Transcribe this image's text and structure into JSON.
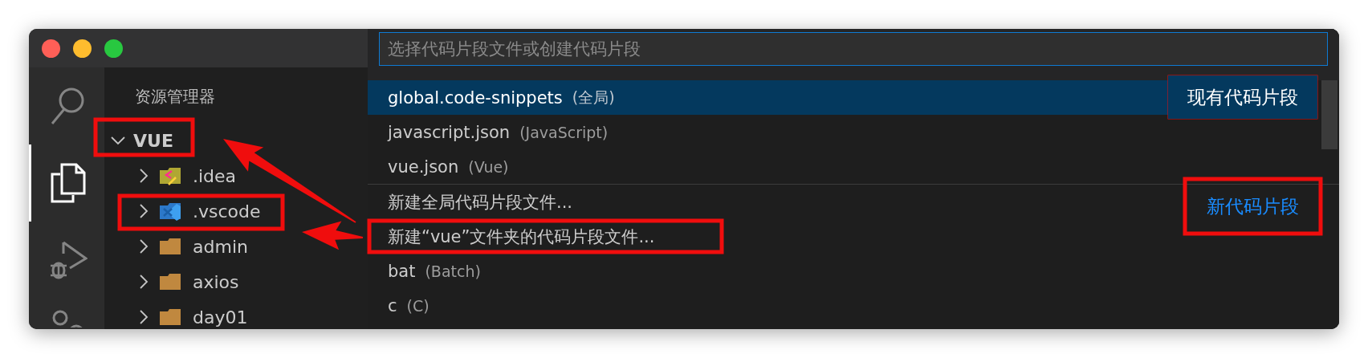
{
  "activity_bar": [
    {
      "kind": "search",
      "selected": false
    },
    {
      "kind": "explorer",
      "selected": true
    },
    {
      "kind": "debug",
      "selected": false
    },
    {
      "kind": "extensions",
      "selected": false
    }
  ],
  "sidebar": {
    "title": "资源管理器",
    "folder": {
      "label": "VUE",
      "expanded": true,
      "children": [
        {
          "label": ".idea",
          "kind": "idea",
          "expanded": false
        },
        {
          "label": ".vscode",
          "kind": "vscode",
          "expanded": false
        },
        {
          "label": "admin",
          "kind": "folder",
          "expanded": false
        },
        {
          "label": "axios",
          "kind": "folder",
          "expanded": false
        },
        {
          "label": "day01",
          "kind": "folder",
          "expanded": false
        }
      ]
    }
  },
  "quick_pick": {
    "placeholder": "选择代码片段文件或创建代码片段",
    "items": [
      {
        "kind": "file",
        "label": "global.code-snippets",
        "description": "(全局)",
        "selected": true
      },
      {
        "kind": "file",
        "label": "javascript.json",
        "description": "(JavaScript)",
        "selected": false
      },
      {
        "kind": "file",
        "label": "vue.json",
        "description": "(Vue)",
        "selected": false
      },
      {
        "kind": "action",
        "label": "新建全局代码片段文件...",
        "selected": false
      },
      {
        "kind": "action",
        "label": "新建“vue”文件夹的代码片段文件...",
        "selected": false
      },
      {
        "kind": "language",
        "label": "bat",
        "description": "(Batch)",
        "selected": false
      },
      {
        "kind": "language",
        "label": "c",
        "description": "(C)",
        "selected": false
      }
    ]
  },
  "annotations": [
    {
      "text": "现有代码片段",
      "color": "#ffffff"
    },
    {
      "text": "新代码片段",
      "color": "#1a8cff"
    }
  ]
}
